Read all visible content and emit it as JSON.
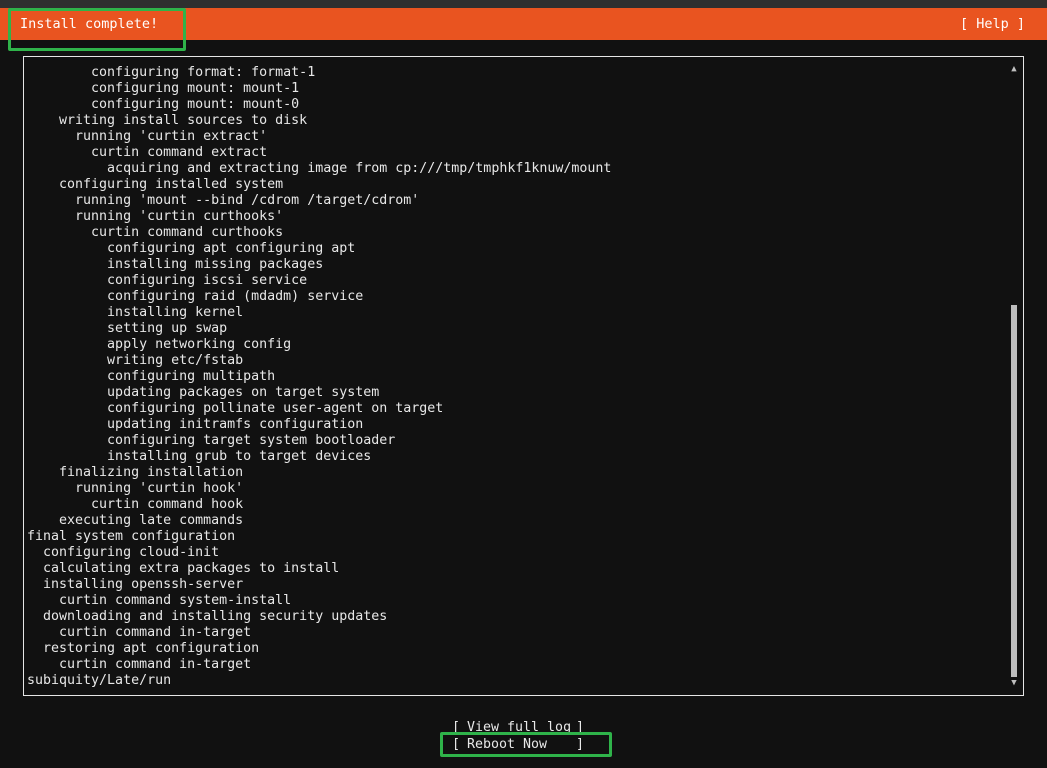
{
  "header": {
    "title": "Install complete!",
    "help_label": "[ Help ]"
  },
  "log": {
    "lines": [
      "        configuring format: format-1",
      "        configuring mount: mount-1",
      "        configuring mount: mount-0",
      "    writing install sources to disk",
      "      running 'curtin extract'",
      "        curtin command extract",
      "          acquiring and extracting image from cp:///tmp/tmphkf1knuw/mount",
      "    configuring installed system",
      "      running 'mount --bind /cdrom /target/cdrom'",
      "      running 'curtin curthooks'",
      "        curtin command curthooks",
      "          configuring apt configuring apt",
      "          installing missing packages",
      "          configuring iscsi service",
      "          configuring raid (mdadm) service",
      "          installing kernel",
      "          setting up swap",
      "          apply networking config",
      "          writing etc/fstab",
      "          configuring multipath",
      "          updating packages on target system",
      "          configuring pollinate user-agent on target",
      "          updating initramfs configuration",
      "          configuring target system bootloader",
      "          installing grub to target devices",
      "    finalizing installation",
      "      running 'curtin hook'",
      "        curtin command hook",
      "    executing late commands",
      "final system configuration",
      "  configuring cloud-init",
      "  calculating extra packages to install",
      "  installing openssh-server",
      "    curtin command system-install",
      "  downloading and installing security updates",
      "    curtin command in-target",
      "  restoring apt configuration",
      "    curtin command in-target",
      "subiquity/Late/run"
    ]
  },
  "buttons": {
    "view_log": "View full log",
    "reboot": "Reboot Now"
  },
  "scrollbar": {
    "up_icon": "▲",
    "down_icon": "▼"
  },
  "colors": {
    "header_bg": "#e95420",
    "highlight": "#2fb34a"
  }
}
